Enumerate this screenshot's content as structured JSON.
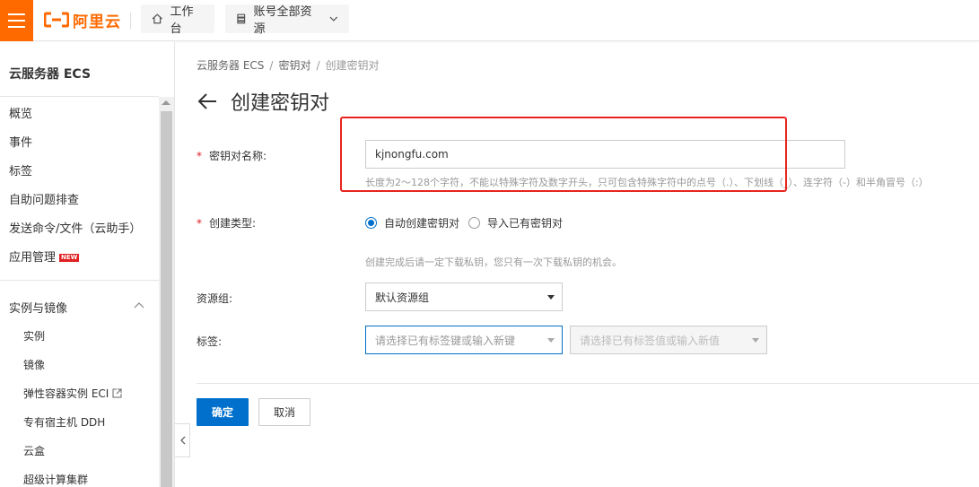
{
  "header": {
    "logo_text": "阿里云",
    "workbench_label": "工作台",
    "resources_label": "账号全部资源"
  },
  "sidebar": {
    "title": "云服务器 ECS",
    "items": [
      {
        "label": "概览"
      },
      {
        "label": "事件"
      },
      {
        "label": "标签"
      },
      {
        "label": "自助问题排查"
      },
      {
        "label": "发送命令/文件（云助手）"
      },
      {
        "label": "应用管理",
        "badge": "NEW"
      }
    ],
    "section_label": "实例与镜像",
    "sub_items": [
      {
        "label": "实例"
      },
      {
        "label": "镜像"
      },
      {
        "label": "弹性容器实例 ECI"
      },
      {
        "label": "专有宿主机 DDH"
      },
      {
        "label": "云盒"
      },
      {
        "label": "超级计算集群"
      }
    ]
  },
  "breadcrumb": {
    "items": [
      "云服务器 ECS",
      "密钥对",
      "创建密钥对"
    ]
  },
  "page": {
    "title": "创建密钥对"
  },
  "form": {
    "name": {
      "label": "密钥对名称:",
      "required_mark": "*",
      "value": "kjnongfu.com",
      "hint": "长度为2～128个字符，不能以特殊字符及数字开头，只可包含特殊字符中的点号（.）、下划线（_）、连字符（-）和半角冒号（:）"
    },
    "type": {
      "label": "创建类型:",
      "required_mark": "*",
      "options": [
        "自动创建密钥对",
        "导入已有密钥对"
      ],
      "selected": "自动创建密钥对",
      "hint": "创建完成后请一定下载私钥，您只有一次下载私钥的机会。"
    },
    "resource_group": {
      "label": "资源组:",
      "value": "默认资源组"
    },
    "tags": {
      "label": "标签:",
      "key_placeholder": "请选择已有标签键或输入新键",
      "value_placeholder": "请选择已有标签值或输入新值"
    }
  },
  "actions": {
    "confirm_label": "确定",
    "cancel_label": "取消"
  },
  "colors": {
    "brand": "#ff6a00",
    "primary": "#0070cc",
    "highlight_box": "#e8241d"
  }
}
